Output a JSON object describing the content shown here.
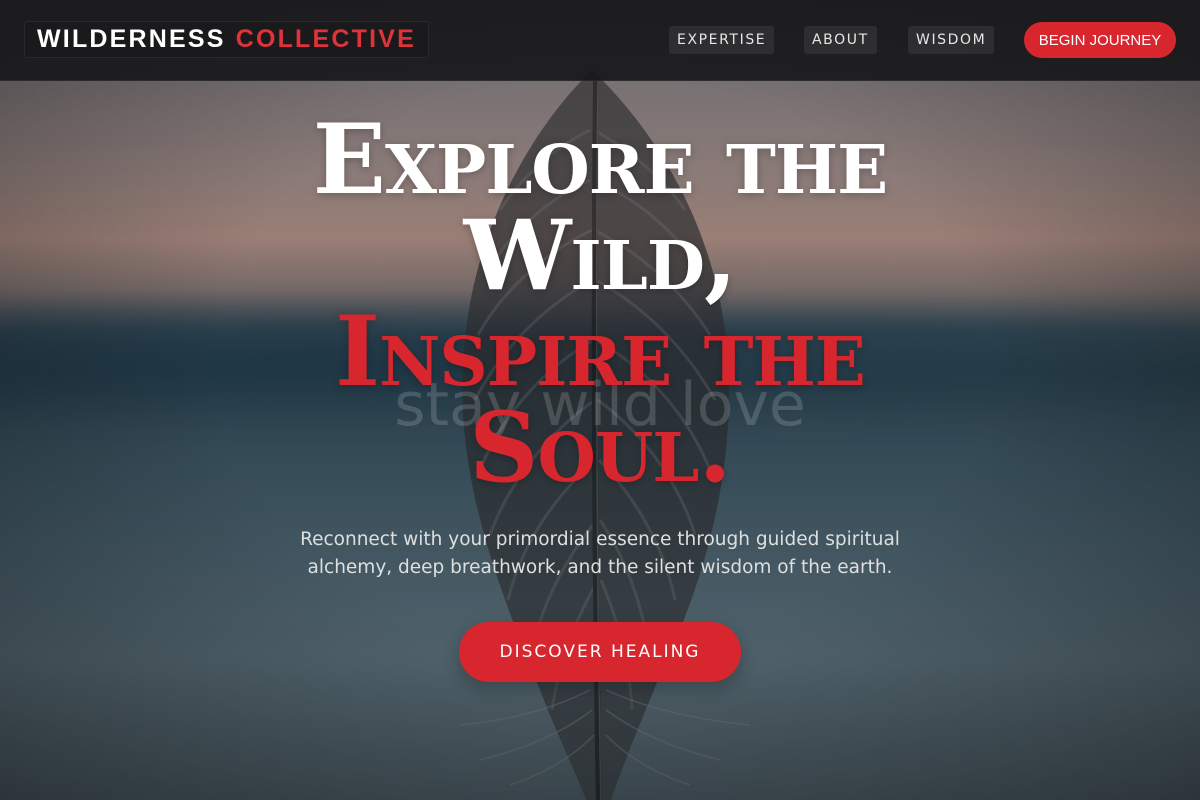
{
  "header": {
    "brand_primary": "WILDERNESS",
    "brand_accent": "COLLECTIVE",
    "nav": {
      "expertise": "EXPERTISE",
      "about": "ABOUT",
      "wisdom": "WISDOM"
    },
    "cta_label": "BEGIN JOURNEY"
  },
  "hero": {
    "headline_line1": "Explore the",
    "headline_line2": "Wild,",
    "headline_line3": "Inspire the",
    "headline_line4": "Soul.",
    "watermark_text": "stay wild love",
    "subtext": "Reconnect with your primordial essence through guided spiritual alchemy, deep breathwork, and the silent wisdom of the earth.",
    "cta_label": "DISCOVER HEALING",
    "background_image": "feather-icon"
  },
  "colors": {
    "accent": "#d7262e",
    "navbar": "#18181a",
    "text_light": "#ffffff"
  }
}
